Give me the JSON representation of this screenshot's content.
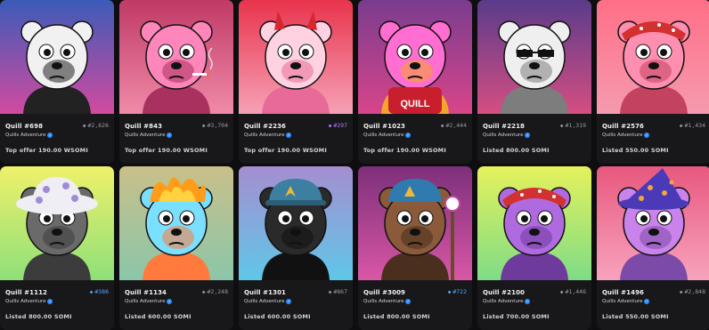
{
  "collection_name": "Quills Adventure",
  "colors": {
    "card_bg": "#18181b",
    "page_bg": "#0e0e10",
    "verified": "#2f8cff"
  },
  "items": [
    {
      "name": "Quill #698",
      "rank": "#2,626",
      "rank_style": "grey",
      "price": "Top offer 190.00 WSOMI",
      "bg_top": "#3b5bb8",
      "bg_bot": "#d24aa0",
      "fur": "#f1f1f1",
      "fur_dark": "#222222",
      "accessory": "none"
    },
    {
      "name": "Quill #843",
      "rank": "#3,704",
      "rank_style": "grey",
      "price": "Top offer 190.00 WSOMI",
      "bg_top": "#c03a66",
      "bg_bot": "#f08aa8",
      "fur": "#ff86ba",
      "fur_dark": "#a8315f",
      "accessory": "cigarette"
    },
    {
      "name": "Quill #2236",
      "rank": "#297",
      "rank_style": "purple",
      "price": "Top offer 190.00 WSOMI",
      "bg_top": "#e8344c",
      "bg_bot": "#f6a1b6",
      "fur": "#ffd2e1",
      "fur_dark": "#e86a98",
      "accessory": "horns"
    },
    {
      "name": "Quill #1023",
      "rank": "#2,444",
      "rank_style": "grey",
      "price": "Top offer 190.00 WSOMI",
      "bg_top": "#7a3c8e",
      "bg_bot": "#d8458a",
      "fur": "#ff6ed0",
      "fur_dark": "#f6a52b",
      "accessory": "jersey"
    },
    {
      "name": "Quill #2218",
      "rank": "#1,319",
      "rank_style": "grey",
      "price": "Listed 800.00 SOMI",
      "bg_top": "#5a3b8a",
      "bg_bot": "#d54e82",
      "fur": "#efefef",
      "fur_dark": "#7d7d7d",
      "accessory": "sunglasses"
    },
    {
      "name": "Quill #2576",
      "rank": "#1,434",
      "rank_style": "grey",
      "price": "Listed 550.00 SOMI",
      "bg_top": "#ff6f86",
      "bg_bot": "#f59ab0",
      "fur": "#ff8fb0",
      "fur_dark": "#c2425f",
      "accessory": "bandana"
    },
    {
      "name": "Quill #1112",
      "rank": "#386",
      "rank_style": "blue",
      "price": "Listed 800.00 SOMI",
      "bg_top": "#eff16a",
      "bg_bot": "#8fe07a",
      "fur": "#6a6a6a",
      "fur_dark": "#3c3c3c",
      "accessory": "bucket-hat"
    },
    {
      "name": "Quill #1134",
      "rank": "#2,248",
      "rank_style": "grey",
      "price": "Listed 600.00 SOMI",
      "bg_top": "#c9c08a",
      "bg_bot": "#8bc6a9",
      "fur": "#7be0ff",
      "fur_dark": "#ff7a3c",
      "accessory": "fire"
    },
    {
      "name": "Quill #1301",
      "rank": "#867",
      "rank_style": "grey",
      "price": "Listed 600.00 SOMI",
      "bg_top": "#a58ed0",
      "bg_bot": "#5fc7e8",
      "fur": "#2a2a2a",
      "fur_dark": "#111111",
      "accessory": "cap"
    },
    {
      "name": "Quill #3009",
      "rank": "#722",
      "rank_style": "blue",
      "price": "Listed 800.00 SOMI",
      "bg_top": "#7d2f7a",
      "bg_bot": "#d957a6",
      "fur": "#8a5a3a",
      "fur_dark": "#4a2f1e",
      "accessory": "staff"
    },
    {
      "name": "Quill #2100",
      "rank": "#1,446",
      "rank_style": "grey",
      "price": "Listed 700.00 SOMI",
      "bg_top": "#e5f25c",
      "bg_bot": "#7fdc86",
      "fur": "#b06adf",
      "fur_dark": "#6e3a9c",
      "accessory": "bandana"
    },
    {
      "name": "Quill #1496",
      "rank": "#2,848",
      "rank_style": "grey",
      "price": "Listed 550.00 SOMI",
      "bg_top": "#e8587e",
      "bg_bot": "#f7a3bd",
      "fur": "#c983ea",
      "fur_dark": "#7c4aa8",
      "accessory": "wizard-hat"
    }
  ]
}
